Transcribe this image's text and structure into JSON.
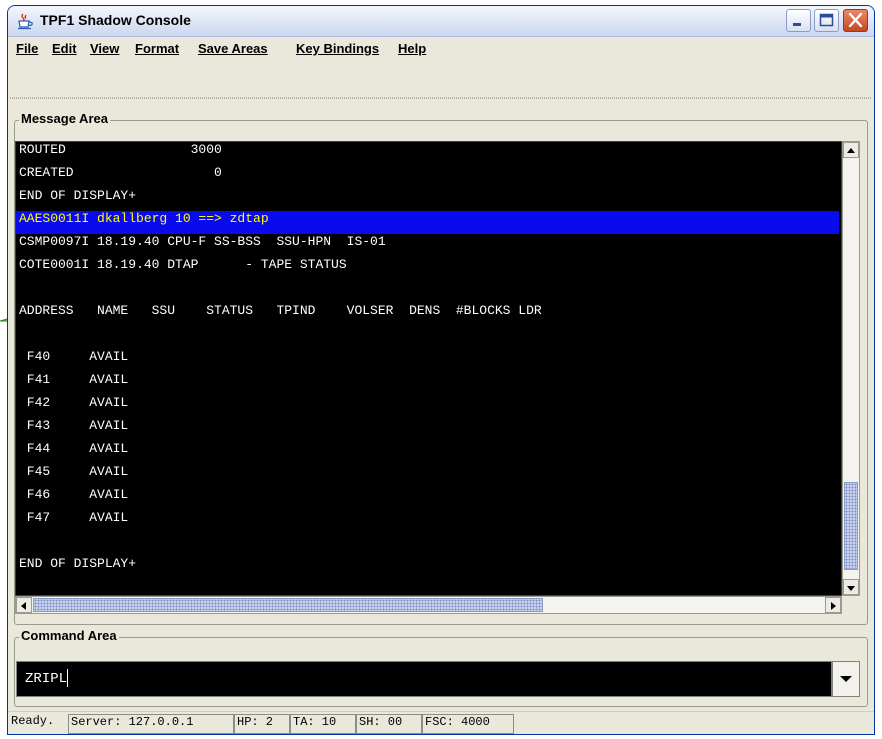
{
  "window": {
    "title": "TPF1 Shadow Console"
  },
  "menu": [
    "File",
    "Edit",
    "View",
    "Format",
    "Save Areas",
    "Key Bindings",
    "Help"
  ],
  "message_area": {
    "label": "Message Area",
    "lines": [
      "ROUTED                3000",
      "CREATED                  0",
      "END OF DISPLAY+",
      "AAES0011I dkallberg 10 ==> zdtap",
      "CSMP0097I 18.19.40 CPU-F SS-BSS  SSU-HPN  IS-01",
      "COTE0001I 18.19.40 DTAP      - TAPE STATUS",
      "",
      "ADDRESS   NAME   SSU    STATUS   TPIND    VOLSER  DENS  #BLOCKS LDR",
      "",
      " F40     AVAIL",
      " F41     AVAIL",
      " F42     AVAIL",
      " F43     AVAIL",
      " F44     AVAIL",
      " F45     AVAIL",
      " F46     AVAIL",
      " F47     AVAIL",
      "",
      "END OF DISPLAY+"
    ],
    "highlighted_line_index": 3
  },
  "command_area": {
    "label": "Command Area",
    "value": "ZRIPL"
  },
  "status_bar": {
    "state": "Ready.",
    "server": "Server: 127.0.0.1",
    "hp": "HP: 2",
    "ta": "TA: 10",
    "sh": "SH: 00",
    "fsc": "FSC: 4000"
  },
  "colors": {
    "console_bg": "#000000",
    "console_text": "#ffffff",
    "highlight_bg": "#0a0aee",
    "highlight_text": "#ffff00",
    "window_border": "#0033a8"
  },
  "icons": [
    "java-cup-icon",
    "minimize-icon",
    "maximize-icon",
    "close-icon",
    "scroll-up-icon",
    "scroll-down-icon",
    "scroll-left-icon",
    "scroll-right-icon",
    "dropdown-arrow-icon",
    "pointer-arrow-icon"
  ]
}
